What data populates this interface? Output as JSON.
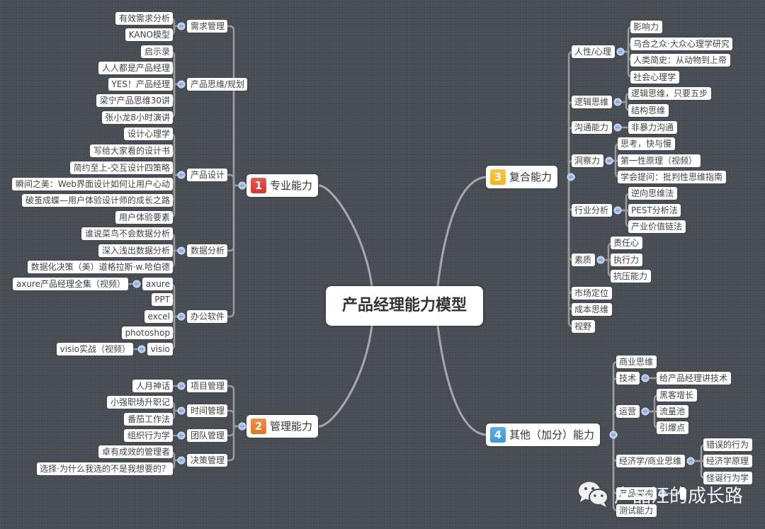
{
  "central": {
    "title": "产品经理能力模型"
  },
  "branches": [
    {
      "id": "b1",
      "number": "1",
      "label": "专业能力",
      "color": "#d9342b",
      "side": "left",
      "children": [
        {
          "label": "需求管理",
          "children": [
            "有效需求分析",
            "KANO模型"
          ]
        },
        {
          "label": "产品思维/规划",
          "children": [
            "启示录",
            "人人都是产品经理",
            "YES！产品经理",
            "梁宁产品思维30讲",
            "张小龙8小时演讲"
          ]
        },
        {
          "label": "产品设计",
          "children": [
            "设计心理学",
            "写给大家看的设计书",
            "简约至上-交互设计四策略",
            "瞬间之美：Web界面设计如何让用户心动",
            "破茧成蝶—用户体验设计师的成长之路",
            "用户体验要素"
          ]
        },
        {
          "label": "数据分析",
          "children": [
            "谁说菜鸟不会数据分析",
            "深入浅出数据分析",
            "数据化决策（美）道格拉斯·w.哈伯德"
          ]
        },
        {
          "label": "办公软件",
          "children": [
            {
              "label": "axure",
              "children": [
                "axure产品经理全集（视频）"
              ]
            },
            {
              "label": "PPT"
            },
            {
              "label": "excel"
            },
            {
              "label": "photoshop"
            },
            {
              "label": "visio",
              "children": [
                "visio实战（视频）"
              ]
            }
          ]
        }
      ]
    },
    {
      "id": "b2",
      "number": "2",
      "label": "管理能力",
      "color": "#e8741c",
      "side": "left",
      "children": [
        {
          "label": "项目管理",
          "children": [
            "人月神话"
          ]
        },
        {
          "label": "时间管理",
          "children": [
            "小强职场升职记",
            "番茄工作法"
          ]
        },
        {
          "label": "团队管理",
          "children": [
            "组织行为学"
          ]
        },
        {
          "label": "决策管理",
          "children": [
            "卓有成效的管理者",
            "选择·为什么我选的不是我想要的？"
          ]
        }
      ]
    },
    {
      "id": "b3",
      "number": "3",
      "label": "复合能力",
      "color": "#f2b81a",
      "side": "right",
      "children": [
        {
          "label": "人性/心理",
          "children": [
            "影响力",
            "乌合之众·大众心理学研究",
            "人类简史：从动物到上帝",
            "社会心理学"
          ]
        },
        {
          "label": "逻辑思维",
          "children": [
            "逻辑思维，只要五步",
            "结构思维"
          ]
        },
        {
          "label": "沟通能力",
          "children": [
            "非暴力沟通"
          ]
        },
        {
          "label": "洞察力",
          "children": [
            "思考，快与慢",
            "第一性原理（视频）",
            "学会提问：批判性思维指南"
          ]
        },
        {
          "label": "行业分析",
          "children": [
            "逆向思维法",
            "PEST分析法",
            "产业价值链法"
          ]
        },
        {
          "label": "素质",
          "children": [
            "责任心",
            "执行力",
            "抗压能力"
          ]
        },
        {
          "label": "市场定位"
        },
        {
          "label": "成本思维"
        },
        {
          "label": "视野"
        }
      ]
    },
    {
      "id": "b4",
      "number": "4",
      "label": "其他（加分）能力",
      "color": "#3a9ad6",
      "side": "right",
      "children": [
        {
          "label": "商业思维"
        },
        {
          "label": "技术",
          "children": [
            "给产品经理讲技术"
          ]
        },
        {
          "label": "运营",
          "children": [
            "黑客增长",
            "流量池",
            "引爆点"
          ]
        },
        {
          "label": "经济学/商业思维",
          "children": [
            "错误的行为",
            "经济学原理",
            "怪诞行为学"
          ]
        },
        {
          "label": "产品架构",
          "children": [
            ""
          ]
        },
        {
          "label": "测试能力"
        }
      ]
    }
  ],
  "watermark": {
    "icon": "wechat-icon",
    "text": "产品汪的成长路"
  }
}
